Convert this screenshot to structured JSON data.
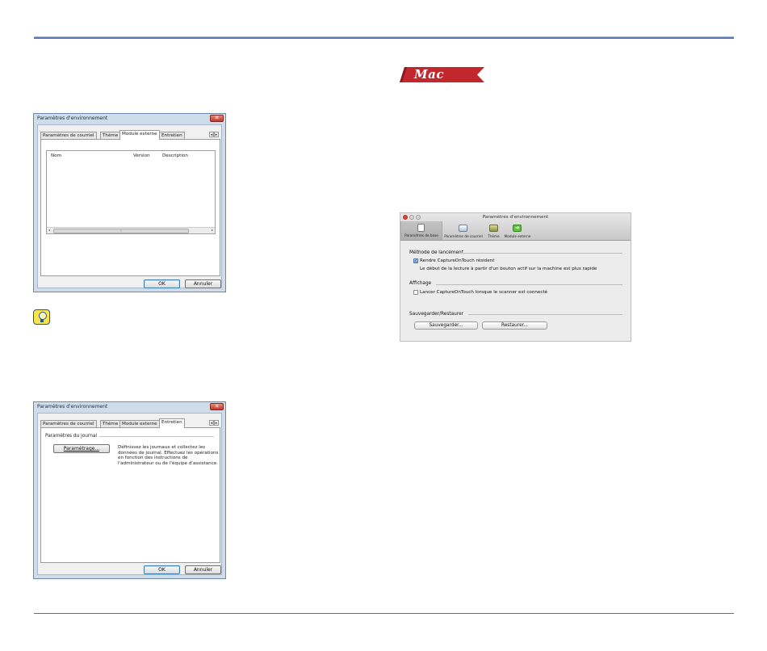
{
  "win1": {
    "title": "Paramètres d'environnement",
    "tabs": [
      "Paramètres de courriel",
      "Thème",
      "Module externe",
      "Entretien"
    ],
    "columns": [
      "Nom",
      "Version",
      "Description"
    ],
    "scroll_thumb_grip": "⁞",
    "ok_label": "OK",
    "cancel_label": "Annuler"
  },
  "win2": {
    "title": "Paramètres d'environnement",
    "tabs": [
      "Paramètres de courriel",
      "Thème",
      "Module externe",
      "Entretien"
    ],
    "group_label": "Paramètres du journal",
    "settings_button": "Paramétrage...",
    "description": [
      "Définissez les journaux et collectez les",
      "données de journal. Effectuez les opérations",
      "en fonction des instructions de",
      "l'administrateur ou de l'équipe d'assistance."
    ],
    "ok_label": "OK",
    "cancel_label": "Annuler"
  },
  "mac_badge": {
    "label": "Mac",
    "color": "#c1272d"
  },
  "mac_win": {
    "title": "Paramètres d'environnement",
    "toolbar": [
      "Paramètres de base",
      "Paramètres de courriel",
      "Thème",
      "Module externe"
    ],
    "launch_section": "Méthode de lancement",
    "resident_checkbox": "Rendre CaptureOnTouch résident",
    "resident_checked": true,
    "resident_note": "Le début de la lecture à partir d'un bouton actif sur la machine est plus rapide",
    "display_section": "Affichage",
    "launch_checkbox": "Lancer CaptureOnTouch lorsque le scanner est connecté",
    "launch_checked": false,
    "backup_section": "Sauvegarder/Restaurer",
    "save_button": "Sauvegarder...",
    "restore_button": "Restaurer..."
  },
  "colors": {
    "rule_blue": "#3d5fa6",
    "win_frame": "#cfdcea",
    "tip_yellow": "#f7e34b"
  }
}
